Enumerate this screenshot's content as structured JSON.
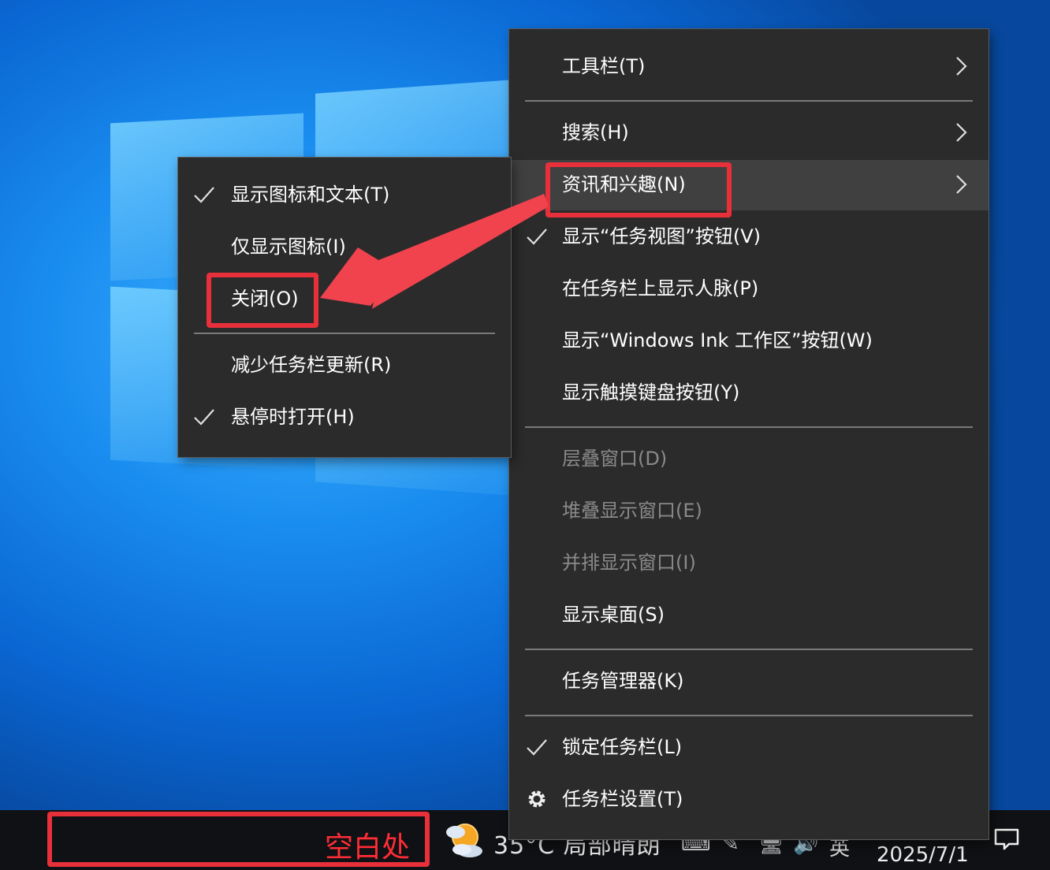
{
  "main_menu": {
    "items": [
      {
        "label": "工具栏(T)"
      },
      {
        "label": "搜索(H)"
      },
      {
        "label": "资讯和兴趣(N)"
      },
      {
        "label": "显示“任务视图”按钮(V)"
      },
      {
        "label": "在任务栏上显示人脉(P)"
      },
      {
        "label": "显示“Windows Ink 工作区”按钮(W)"
      },
      {
        "label": "显示触摸键盘按钮(Y)"
      },
      {
        "label": "层叠窗口(D)"
      },
      {
        "label": "堆叠显示窗口(E)"
      },
      {
        "label": "并排显示窗口(I)"
      },
      {
        "label": "显示桌面(S)"
      },
      {
        "label": "任务管理器(K)"
      },
      {
        "label": "锁定任务栏(L)"
      },
      {
        "label": "任务栏设置(T)"
      }
    ]
  },
  "sub_menu": {
    "items": [
      {
        "label": "显示图标和文本(T)"
      },
      {
        "label": "仅显示图标(I)"
      },
      {
        "label": "关闭(O)"
      },
      {
        "label": "减少任务栏更新(R)"
      },
      {
        "label": "悬停时打开(H)"
      }
    ]
  },
  "taskbar": {
    "blank_area_label": "空白处",
    "weather_text": "35°C 局部晴朗",
    "clock_date": "2025/7/1",
    "ime_label": "英"
  },
  "colors": {
    "highlight": "#e8303b",
    "menu_bg": "#2b2b2b"
  }
}
